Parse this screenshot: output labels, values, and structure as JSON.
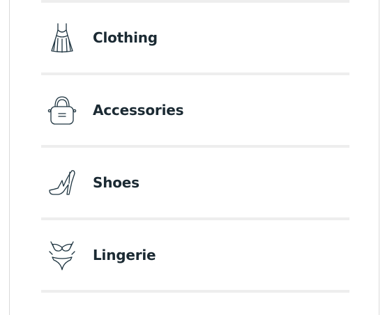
{
  "categories": {
    "items": [
      {
        "label": "Clothing",
        "icon": "dress-icon"
      },
      {
        "label": "Accessories",
        "icon": "handbag-icon"
      },
      {
        "label": "Shoes",
        "icon": "high-heel-icon"
      },
      {
        "label": "Lingerie",
        "icon": "lingerie-icon"
      }
    ]
  },
  "colors": {
    "text": "#1b2a33",
    "icon_stroke": "#1e3440",
    "divider": "#eeeeee",
    "border": "#d9d9d9"
  }
}
